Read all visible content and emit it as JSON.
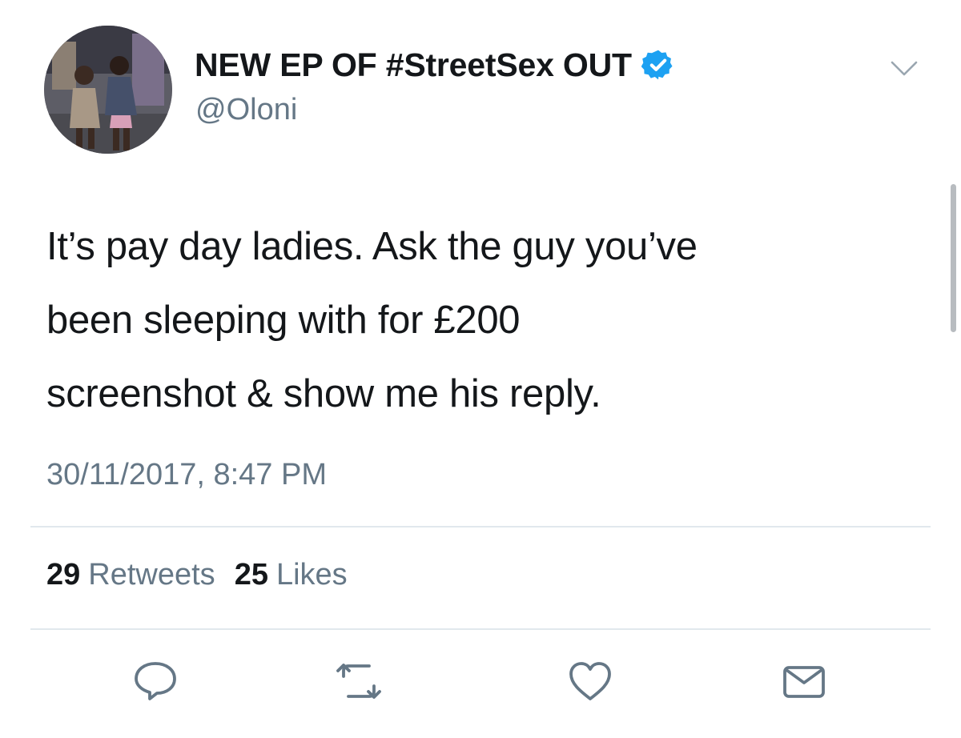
{
  "tweet": {
    "display_name": "NEW EP OF #StreetSex OUT",
    "handle": "@Oloni",
    "verified_icon": "verified-badge-icon",
    "menu_icon": "chevron-down-icon",
    "text_lines": [
      "It’s pay day ladies. Ask the guy you’ve",
      "been sleeping with for £200",
      "screenshot & show me his reply."
    ],
    "timestamp": "30/11/2017, 8:47 PM",
    "stats": {
      "retweets_count": "29",
      "retweets_label": "Retweets",
      "likes_count": "25",
      "likes_label": "Likes"
    },
    "actions": [
      {
        "icon": "reply-icon"
      },
      {
        "icon": "retweet-icon"
      },
      {
        "icon": "heart-icon"
      },
      {
        "icon": "envelope-icon"
      }
    ]
  },
  "colors": {
    "text_primary": "#14171a",
    "text_secondary": "#657786",
    "verified_blue": "#1da1f2",
    "divider": "#e1e8ed"
  }
}
